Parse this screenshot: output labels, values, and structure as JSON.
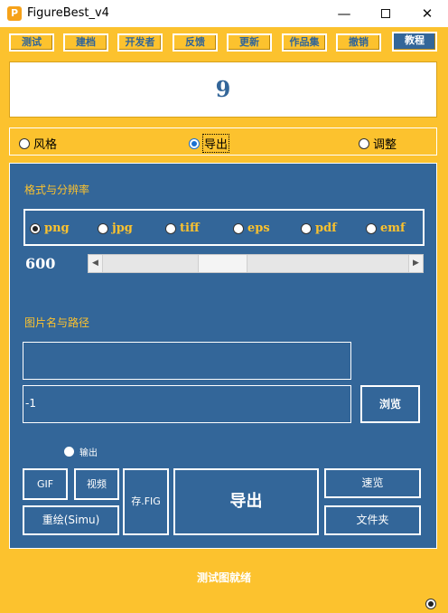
{
  "window": {
    "title": "FigureBest_v4",
    "icon_letter": "P",
    "minimize_glyph": "—",
    "close_glyph": "✕"
  },
  "toolbar": {
    "buttons": [
      "测试",
      "建档",
      "开发者",
      "反馈",
      "更新",
      "作品集",
      "撤销",
      "教程"
    ],
    "active_index": 7
  },
  "display": {
    "value": "9"
  },
  "modes": {
    "options": [
      "风格",
      "导出",
      "调整"
    ],
    "selected": "导出"
  },
  "export_panel": {
    "format_section_label": "格式与分辨率",
    "formats": [
      "png",
      "jpg",
      "tiff",
      "eps",
      "pdf",
      "emf"
    ],
    "selected_format": "png",
    "dpi_value": "600",
    "dpi_slider_level": 0.37,
    "scroll_left_glyph": "◀",
    "scroll_right_glyph": "▶",
    "path_section_label": "图片名与路径",
    "name_field_value": "",
    "path_field_value": "-1",
    "browse_button": "浏览",
    "output_radio_label": "输出",
    "gif_button": "GIF",
    "video_button": "视频",
    "save_fig_button": "存.FIG",
    "export_button": "导出",
    "preview_button": "速览",
    "redraw_button": "重绘(Simu)",
    "folder_button": "文件夹"
  },
  "status": {
    "text": "测试图就绪"
  },
  "colors": {
    "background": "#fcc22e",
    "panel": "#336699",
    "accent_text": "#fcc22e",
    "radio_selected": "#1a6fd0"
  }
}
